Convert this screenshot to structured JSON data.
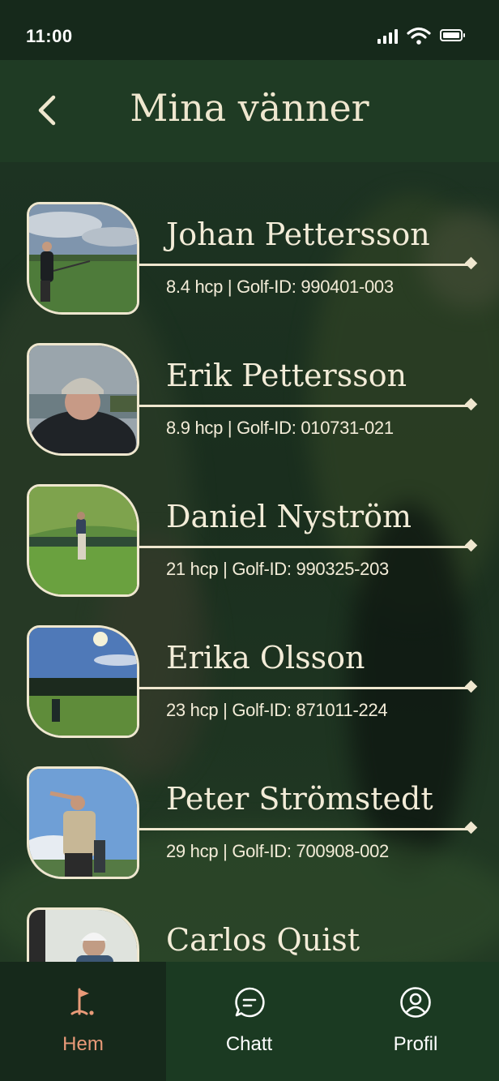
{
  "status_bar": {
    "time": "11:00"
  },
  "header": {
    "title": "Mina vänner"
  },
  "friends": [
    {
      "name": "Johan Pettersson",
      "hcp": "8.4 hcp",
      "golf_id": "Golf-ID: 990401-003"
    },
    {
      "name": "Erik Pettersson",
      "hcp": "8.9 hcp",
      "golf_id": "Golf-ID: 010731-021"
    },
    {
      "name": "Daniel Nyström",
      "hcp": "21 hcp",
      "golf_id": "Golf-ID: 990325-203"
    },
    {
      "name": "Erika Olsson",
      "hcp": "23 hcp",
      "golf_id": "Golf-ID: 871011-224"
    },
    {
      "name": "Peter Strömstedt",
      "hcp": "29 hcp",
      "golf_id": "Golf-ID: 700908-002"
    },
    {
      "name": "Carlos Quist",
      "hcp": "",
      "golf_id": ""
    }
  ],
  "meta_separator": " | ",
  "nav": {
    "items": [
      {
        "label": "Hem",
        "icon": "golf-flag-icon",
        "active": true
      },
      {
        "label": "Chatt",
        "icon": "chat-icon",
        "active": false
      },
      {
        "label": "Profil",
        "icon": "profile-icon",
        "active": false
      }
    ]
  },
  "colors": {
    "background": "#16291b",
    "header": "#1f3b24",
    "cream": "#efe7cf",
    "accent_active": "#e89a78"
  }
}
